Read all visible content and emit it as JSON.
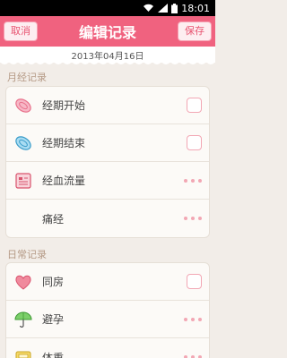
{
  "status_bar": {
    "time": "18:01"
  },
  "header": {
    "cancel_label": "取消",
    "title": "编辑记录",
    "save_label": "保存"
  },
  "date": "2013年04月16日",
  "sections": [
    {
      "label": "月经记录",
      "items": [
        {
          "label": "经期开始",
          "icon": "pink-sanitary-pad-icon",
          "control": "checkbox"
        },
        {
          "label": "经期结束",
          "icon": "blue-sanitary-pad-icon",
          "control": "checkbox"
        },
        {
          "label": "经血流量",
          "icon": "flow-chart-card-icon",
          "control": "more"
        },
        {
          "label": "痛经",
          "icon": "",
          "control": "more"
        }
      ]
    },
    {
      "label": "日常记录",
      "items": [
        {
          "label": "同房",
          "icon": "heart-icon",
          "control": "checkbox"
        },
        {
          "label": "避孕",
          "icon": "umbrella-icon",
          "control": "more"
        },
        {
          "label": "体重",
          "icon": "scale-icon",
          "control": "more"
        }
      ]
    }
  ],
  "colors": {
    "header_pink": "#f0627f",
    "background": "#f2ede8",
    "accent_border": "#f2a7b4",
    "section_label": "#b59a86"
  }
}
